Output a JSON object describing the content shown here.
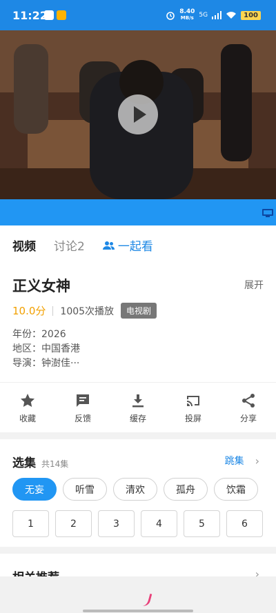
{
  "status_bar": {
    "time": "11:22",
    "net_speed_value": "8.40",
    "net_speed_unit": "MB/s",
    "network": "5G",
    "battery": "100"
  },
  "player": {
    "state": "paused"
  },
  "tabs": [
    {
      "label": "视频",
      "active": true
    },
    {
      "label": "讨论2",
      "active": false
    },
    {
      "label": "一起看",
      "active": false
    }
  ],
  "show": {
    "title": "正义女神",
    "expand_label": "展开",
    "score": "10.0分",
    "plays": "1005次播放",
    "category": "电视剧",
    "year": "年份：2026",
    "region": "地区：中国香港",
    "director": "导演：钟澍佳···"
  },
  "actions": [
    {
      "label": "收藏",
      "icon": "star-icon"
    },
    {
      "label": "反馈",
      "icon": "feedback-icon"
    },
    {
      "label": "缓存",
      "icon": "download-icon"
    },
    {
      "label": "投屏",
      "icon": "cast-icon"
    },
    {
      "label": "分享",
      "icon": "share-icon"
    }
  ],
  "episodes": {
    "title": "选集",
    "count": "共14集",
    "jump_label": "跳集",
    "chips": [
      "无妄",
      "听雪",
      "清欢",
      "孤舟",
      "饮霜"
    ],
    "numbers": [
      "1",
      "2",
      "3",
      "4",
      "5",
      "6"
    ]
  },
  "related": {
    "title": "相关推荐"
  },
  "colors": {
    "accent": "#2196f3",
    "score": "#f2a000"
  }
}
